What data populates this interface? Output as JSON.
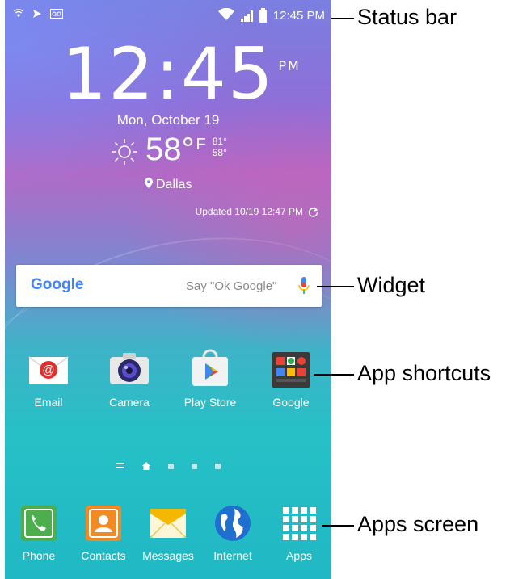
{
  "status_bar": {
    "time": "12:45 PM",
    "left_icons": [
      "hotspot-icon",
      "send-icon",
      "voicemail-icon"
    ],
    "right_icons": [
      "wifi-icon",
      "signal-icon",
      "battery-icon"
    ]
  },
  "clock_widget": {
    "time": "12:45",
    "ampm": "PM",
    "date": "Mon, October 19",
    "temperature": "58°",
    "unit": "F",
    "high": "81°",
    "low": "58°",
    "location": "Dallas",
    "updated": "Updated 10/19 12:47 PM"
  },
  "google_widget": {
    "logo": "Google",
    "hint": "Say \"Ok Google\""
  },
  "app_shortcuts": [
    {
      "label": "Email"
    },
    {
      "label": "Camera"
    },
    {
      "label": "Play Store"
    },
    {
      "label": "Google"
    }
  ],
  "dock": [
    {
      "label": "Phone"
    },
    {
      "label": "Contacts"
    },
    {
      "label": "Messages"
    },
    {
      "label": "Internet"
    },
    {
      "label": "Apps"
    }
  ],
  "callouts": {
    "status_bar": "Status bar",
    "widget": "Widget",
    "app_shortcuts": "App shortcuts",
    "apps_screen": "Apps screen"
  },
  "colors": {
    "google_blue": "#4285F4",
    "google_red": "#EA4335",
    "google_yellow": "#FBBC05",
    "google_green": "#34A853"
  }
}
